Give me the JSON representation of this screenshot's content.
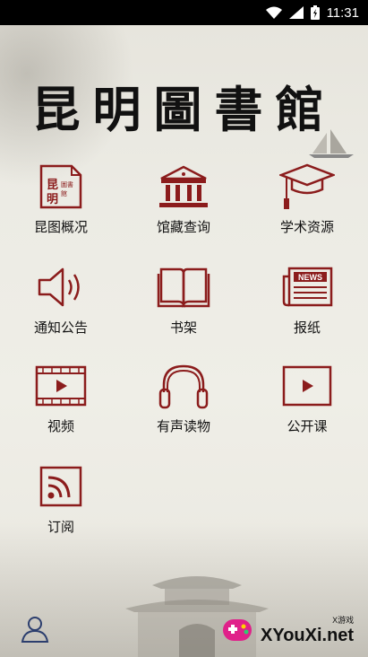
{
  "status_bar": {
    "time": "11:31"
  },
  "header": {
    "title": "昆明圖書館"
  },
  "menu": {
    "items": [
      {
        "label": "昆图概况",
        "icon": "library-logo-icon"
      },
      {
        "label": "馆藏查询",
        "icon": "building-icon"
      },
      {
        "label": "学术资源",
        "icon": "graduation-cap-icon"
      },
      {
        "label": "通知公告",
        "icon": "speaker-icon"
      },
      {
        "label": "书架",
        "icon": "open-book-icon"
      },
      {
        "label": "报纸",
        "icon": "newspaper-icon"
      },
      {
        "label": "视频",
        "icon": "video-film-icon"
      },
      {
        "label": "有声读物",
        "icon": "headphones-icon"
      },
      {
        "label": "公开课",
        "icon": "play-screen-icon"
      },
      {
        "label": "订阅",
        "icon": "rss-icon"
      }
    ],
    "icon_badge_text": "NEWS",
    "logo_badge_text": "昆明圖書館"
  },
  "watermark": {
    "small": "X游戏",
    "big": "XYouXi.net"
  },
  "colors": {
    "accent": "#8b1c1c",
    "text": "#111111"
  }
}
